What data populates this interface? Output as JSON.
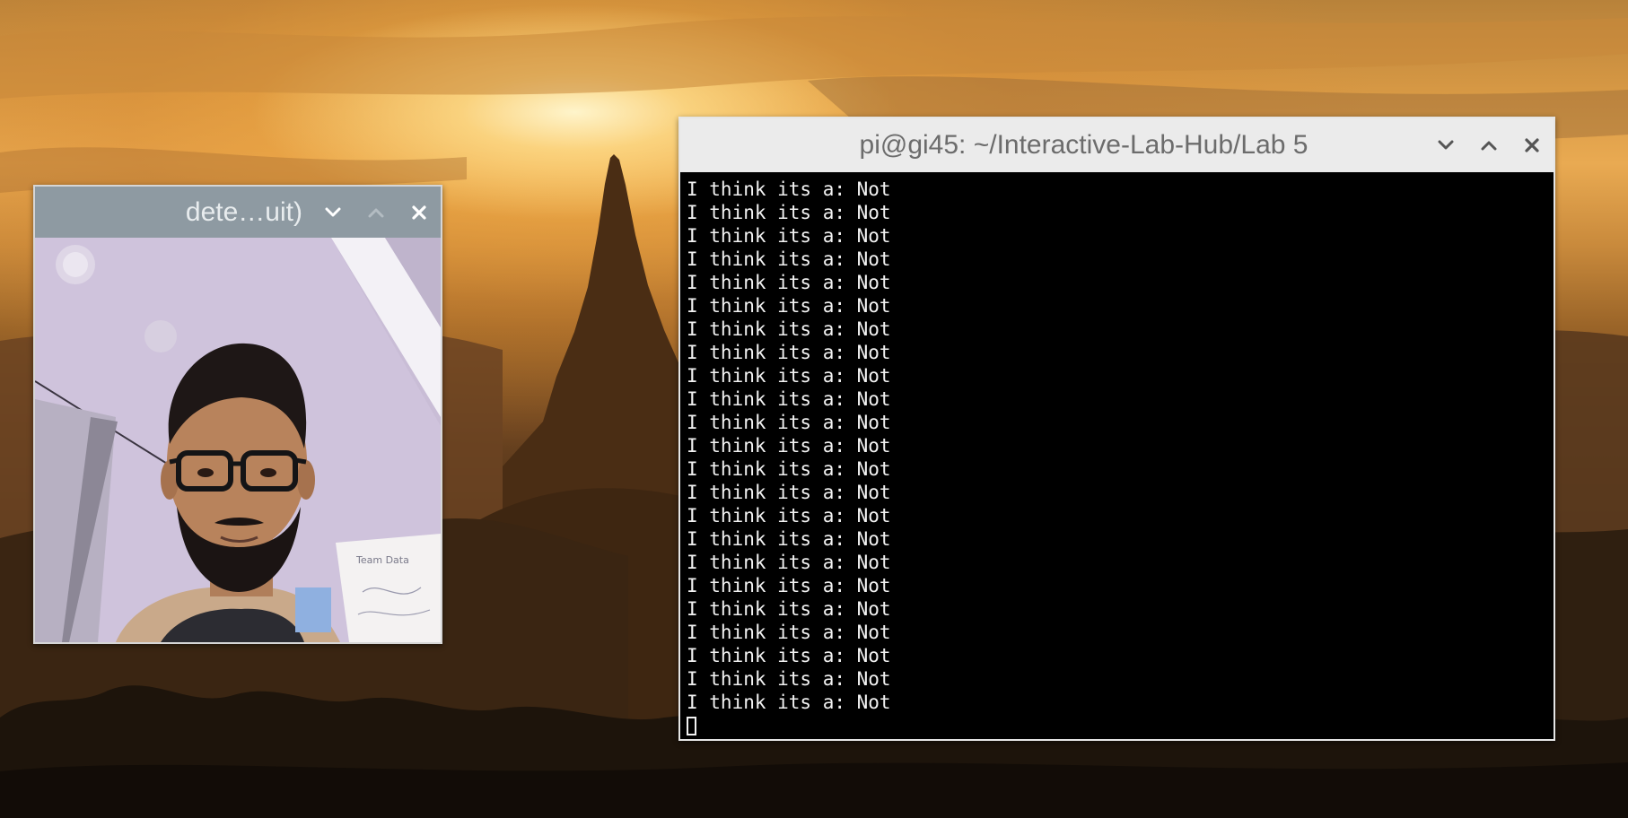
{
  "desktop": {
    "wallpaper": "sunset-temple"
  },
  "camera_window": {
    "title": "dete…uit)",
    "buttons": {
      "minimize": "chevron-down-icon",
      "maximize": "chevron-up-icon",
      "close": "close-icon"
    },
    "view": "webcam-frame-person-with-glasses"
  },
  "terminal_window": {
    "title": "pi@gi45: ~/Interactive-Lab-Hub/Lab 5",
    "buttons": {
      "minimize": "chevron-down-icon",
      "maximize": "chevron-up-icon",
      "close": "close-icon"
    },
    "lines": [
      "I think its a: Not",
      "I think its a: Not",
      "I think its a: Not",
      "I think its a: Not",
      "I think its a: Not",
      "I think its a: Not",
      "I think its a: Not",
      "I think its a: Not",
      "I think its a: Not",
      "I think its a: Not",
      "I think its a: Not",
      "I think its a: Not",
      "I think its a: Not",
      "I think its a: Not",
      "I think its a: Not",
      "I think its a: Not",
      "I think its a: Not",
      "I think its a: Not",
      "I think its a: Not",
      "I think its a: Not",
      "I think its a: Not",
      "I think its a: Not",
      "I think its a: Not"
    ]
  },
  "colors": {
    "camera_titlebar": "#8e9aa2",
    "terminal_titlebar": "#ebebeb",
    "terminal_bg": "#000000",
    "terminal_fg": "#f2f2f2"
  }
}
